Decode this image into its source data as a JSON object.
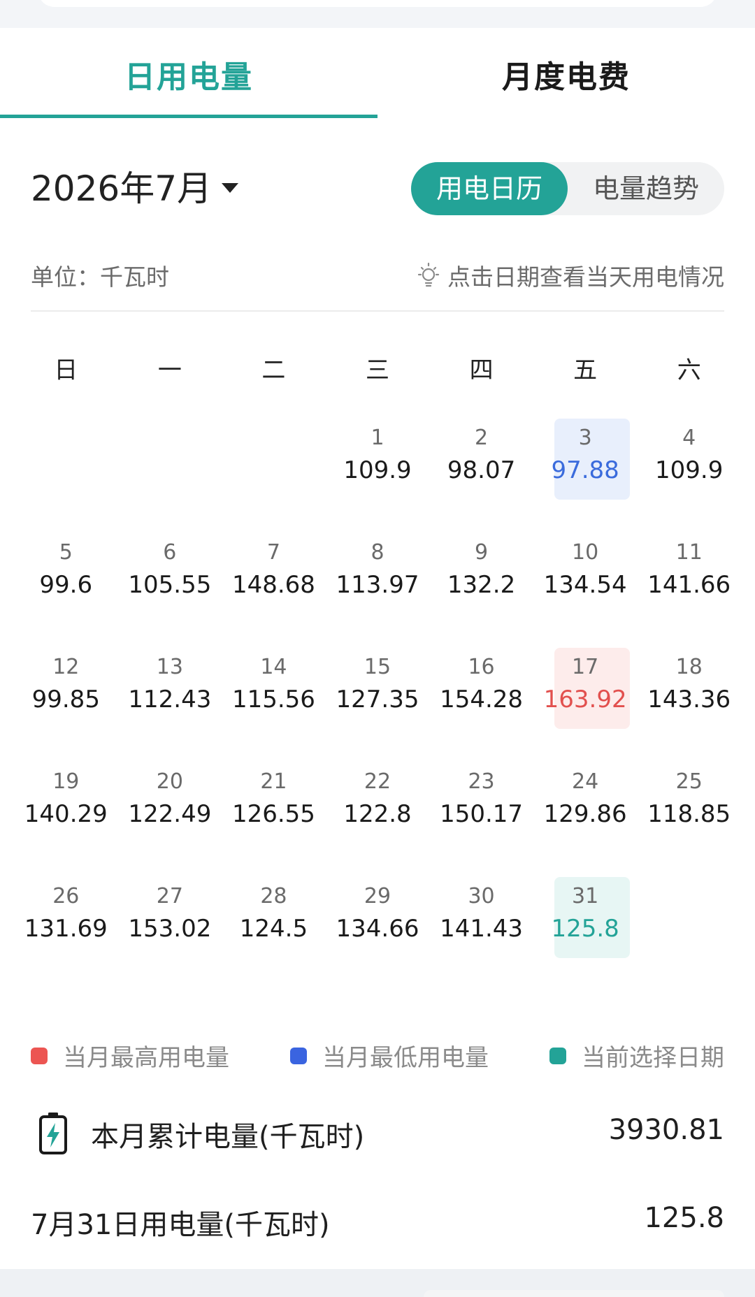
{
  "tabs": {
    "daily": "日用电量",
    "monthly": "月度电费"
  },
  "month_picker": {
    "label": "2026年7月"
  },
  "view_toggle": {
    "calendar": "用电日历",
    "trend": "电量趋势"
  },
  "info": {
    "unit": "单位：千瓦时",
    "hint": "点击日期查看当天用电情况"
  },
  "weekdays": [
    "日",
    "一",
    "二",
    "三",
    "四",
    "五",
    "六"
  ],
  "calendar": {
    "leading_blanks": 3,
    "days": [
      {
        "day": "1",
        "value": "109.9"
      },
      {
        "day": "2",
        "value": "98.07"
      },
      {
        "day": "3",
        "value": "97.88",
        "status": "min"
      },
      {
        "day": "4",
        "value": "109.9"
      },
      {
        "day": "5",
        "value": "99.6"
      },
      {
        "day": "6",
        "value": "105.55"
      },
      {
        "day": "7",
        "value": "148.68"
      },
      {
        "day": "8",
        "value": "113.97"
      },
      {
        "day": "9",
        "value": "132.2"
      },
      {
        "day": "10",
        "value": "134.54"
      },
      {
        "day": "11",
        "value": "141.66"
      },
      {
        "day": "12",
        "value": "99.85"
      },
      {
        "day": "13",
        "value": "112.43"
      },
      {
        "day": "14",
        "value": "115.56"
      },
      {
        "day": "15",
        "value": "127.35"
      },
      {
        "day": "16",
        "value": "154.28"
      },
      {
        "day": "17",
        "value": "163.92",
        "status": "max"
      },
      {
        "day": "18",
        "value": "143.36"
      },
      {
        "day": "19",
        "value": "140.29"
      },
      {
        "day": "20",
        "value": "122.49"
      },
      {
        "day": "21",
        "value": "126.55"
      },
      {
        "day": "22",
        "value": "122.8"
      },
      {
        "day": "23",
        "value": "150.17"
      },
      {
        "day": "24",
        "value": "129.86"
      },
      {
        "day": "25",
        "value": "118.85"
      },
      {
        "day": "26",
        "value": "131.69"
      },
      {
        "day": "27",
        "value": "153.02"
      },
      {
        "day": "28",
        "value": "124.5"
      },
      {
        "day": "29",
        "value": "134.66"
      },
      {
        "day": "30",
        "value": "141.43"
      },
      {
        "day": "31",
        "value": "125.8",
        "status": "sel"
      }
    ]
  },
  "legend": {
    "max": "当月最高用电量",
    "min": "当月最低用电量",
    "selected": "当前选择日期"
  },
  "summary": {
    "total_label": "本月累计电量(千瓦时)",
    "total_value": "3930.81",
    "day_label": "7月31日用电量(千瓦时)",
    "day_value": "125.8"
  },
  "colors": {
    "accent": "#23a397",
    "max": "#e2504e",
    "min": "#3a6bdc"
  }
}
